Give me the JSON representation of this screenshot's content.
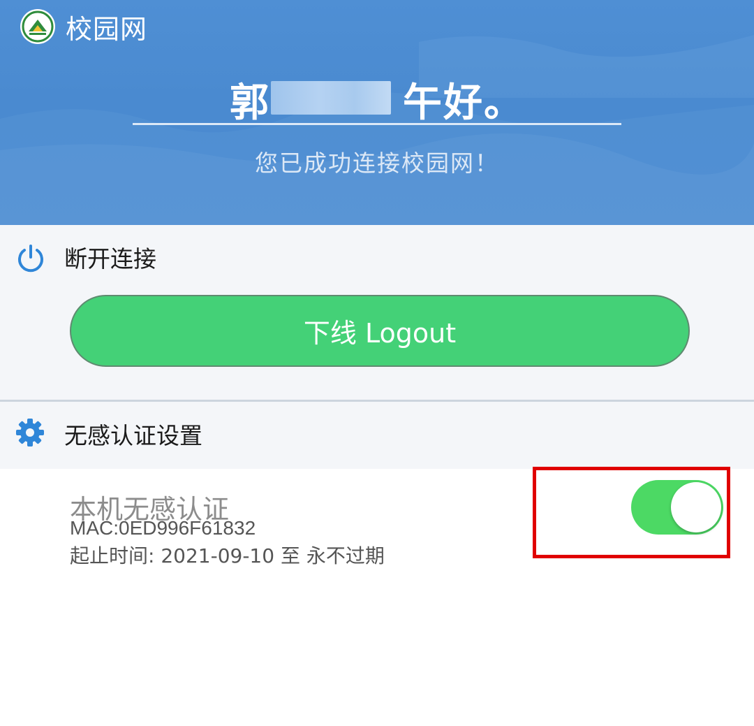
{
  "app": {
    "title": "校园网"
  },
  "header": {
    "greeting_prefix": "郭",
    "greeting_suffix": "午好。",
    "status": "您已成功连接校园网！"
  },
  "disconnect": {
    "title": "断开连接",
    "logout_label": "下线 Logout"
  },
  "auth_settings": {
    "title": "无感认证设置",
    "item": {
      "title": "本机无感认证",
      "mac": "MAC:0ED996F61832",
      "period": "起止时间: 2021-09-10 至 永不过期",
      "enabled": true
    }
  },
  "colors": {
    "header_blue": "#4a8ad0",
    "button_green": "#44d177",
    "toggle_green": "#4cd964",
    "highlight_red": "#e00000",
    "icon_blue": "#2f86d8"
  },
  "icons": [
    "campus-logo",
    "power-icon",
    "gear-icon"
  ]
}
